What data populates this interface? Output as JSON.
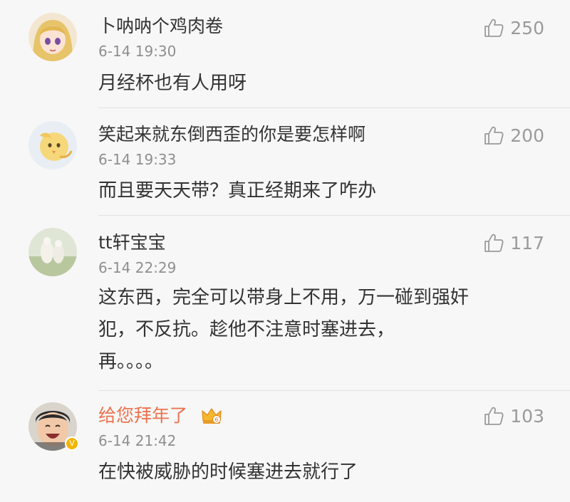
{
  "comments": [
    {
      "username": "卜呐呐个鸡肉卷",
      "timestamp": "6-14 19:30",
      "likes": "250",
      "body": [
        "月经杯也有人用呀"
      ]
    },
    {
      "username": "笑起来就东倒西歪的你是要怎样啊",
      "timestamp": "6-14 19:33",
      "likes": "200",
      "body": [
        "而且要天天带？真正经期来了咋办"
      ]
    },
    {
      "username": "tt轩宝宝",
      "timestamp": "6-14 22:29",
      "likes": "117",
      "body": [
        "这东西，完全可以带身上不用，万一碰到强奸",
        "犯，不反抗。趁他不注意时塞进去，",
        "再。。。。"
      ]
    },
    {
      "username": "给您拜年了",
      "timestamp": "6-14 21:42",
      "likes": "103",
      "body": [
        "在快被威胁的时候塞进去就行了"
      ],
      "vip_badge": "V",
      "crown_badge_label": "6"
    }
  ],
  "colors": {
    "username": "#333333",
    "vip_username": "#eb7350",
    "meta": "#8f8f8f",
    "background": "#f7f7f7"
  },
  "icons": {
    "like": "thumbs-up-icon",
    "crown": "crown-icon"
  }
}
